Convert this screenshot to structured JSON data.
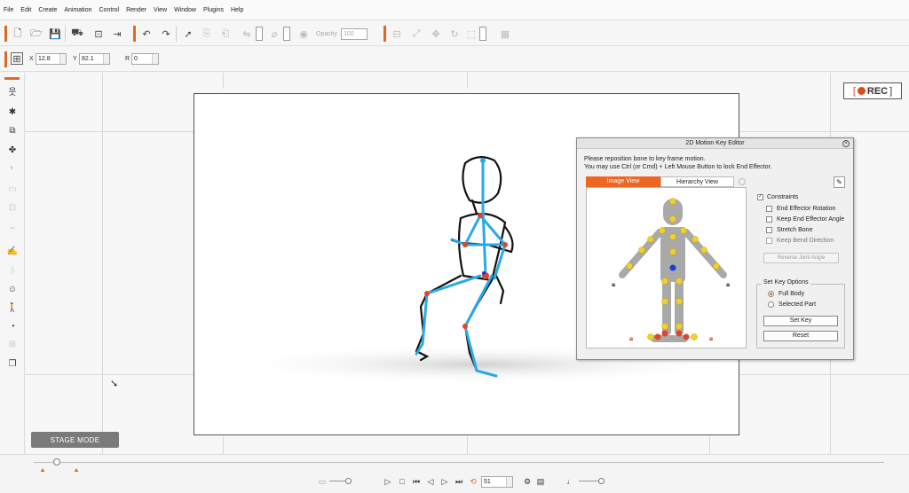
{
  "menu": [
    "File",
    "Edit",
    "Create",
    "Animation",
    "Control",
    "Render",
    "View",
    "Window",
    "Plugins",
    "Help"
  ],
  "toolbar": {
    "opacity_label": "Opacity",
    "opacity_value": "100"
  },
  "transform": {
    "x_label": "X",
    "x_value": "12.8",
    "y_label": "Y",
    "y_value": "82.1",
    "r_label": "R",
    "r_value": "0"
  },
  "rec_label": "REC",
  "stage_mode_label": "STAGE MODE",
  "playback": {
    "frame": "51"
  },
  "dialog": {
    "title": "2D Motion Key Editor",
    "instructions_line1": "Please reposition bone to key frame motion.",
    "instructions_line2": "You may use Ctrl (or Cmd) + Left Mouse Button to lock End Effector.",
    "tab_image": "Image View",
    "tab_hierarchy": "Hierarchy View",
    "constraints_label": "Constraints",
    "options": [
      "End Effector Rotation",
      "Keep End Effector Angle",
      "Stretch Bone",
      "Keep Bend Direction"
    ],
    "reverse_label": "Reverse Joint Angle",
    "set_key_options_label": "Set Key Options",
    "full_body_label": "Full Body",
    "selected_part_label": "Selected Part",
    "set_key_label": "Set Key",
    "reset_label": "Reset"
  },
  "colors": {
    "accent": "#ee6623",
    "bone": "#2aa9e8",
    "joint": "#f2d02b",
    "joint_red": "#e0462a"
  }
}
